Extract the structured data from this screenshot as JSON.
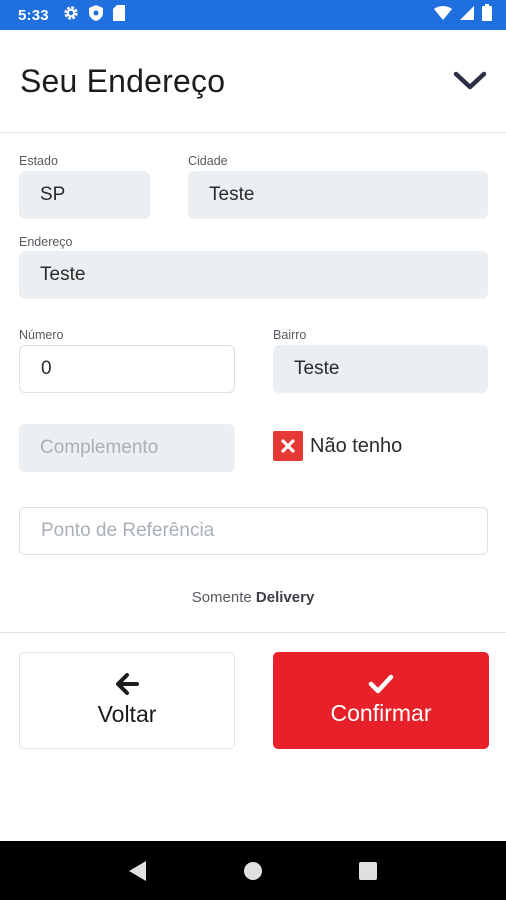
{
  "status_bar": {
    "time": "5:33"
  },
  "header": {
    "title": "Seu Endereço"
  },
  "form": {
    "estado": {
      "label": "Estado",
      "value": "SP"
    },
    "cidade": {
      "label": "Cidade",
      "value": "Teste"
    },
    "endereco": {
      "label": "Endereço",
      "value": "Teste"
    },
    "numero": {
      "label": "Número",
      "value": "0"
    },
    "bairro": {
      "label": "Bairro",
      "value": "Teste"
    },
    "complemento": {
      "placeholder": "Complemento"
    },
    "nao_tenho": {
      "label": "Não tenho",
      "checked": true
    },
    "referencia": {
      "placeholder": "Ponto de Referência"
    }
  },
  "delivery_note": {
    "prefix": "Somente",
    "emphasis": "Delivery"
  },
  "buttons": {
    "back_label": "Voltar",
    "confirm_label": "Confirmar"
  },
  "colors": {
    "status_bar": "#1f6fde",
    "accent_red": "#e8202a",
    "field_fill": "#eceff1"
  },
  "icons": {
    "status": [
      "gear-icon",
      "shield-icon",
      "sd-card-icon",
      "wifi-icon",
      "signal-icon",
      "battery-icon"
    ],
    "header": "chevron-down-icon",
    "checkbox": "close-icon",
    "back": "arrow-left-icon",
    "confirm": "check-icon",
    "nav": [
      "back-triangle-icon",
      "home-circle-icon",
      "recents-square-icon"
    ]
  }
}
